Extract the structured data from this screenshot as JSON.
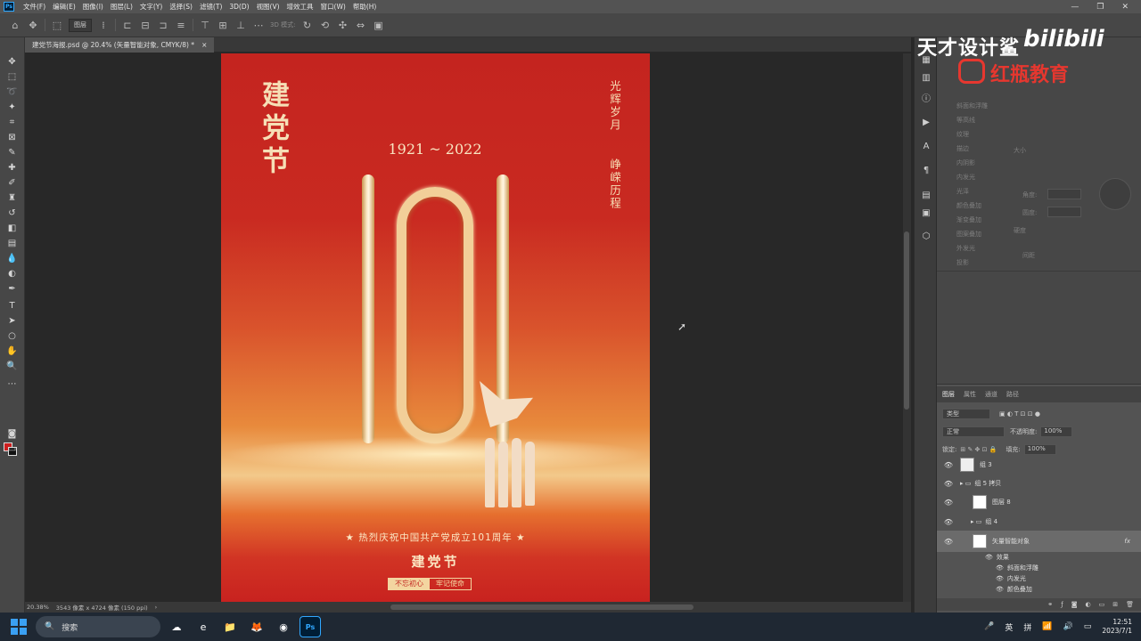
{
  "menu": {
    "app_icon": "Ps",
    "items": [
      "文件(F)",
      "编辑(E)",
      "图像(I)",
      "图层(L)",
      "文字(Y)",
      "选择(S)",
      "滤镜(T)",
      "3D(D)",
      "视图(V)",
      "增效工具",
      "窗口(W)",
      "帮助(H)"
    ],
    "window_controls": [
      "—",
      "❐",
      "✕"
    ]
  },
  "options": {
    "layer_select": "图层",
    "mode_3d": "3D 模式:"
  },
  "document": {
    "tab_title": "建党节海报.psd @ 20.4% (矢量智能对象, CMYK/8) *",
    "zoom": "20.38%",
    "dims": "3543 像素 x 4724 像素 (150 ppi)"
  },
  "poster": {
    "title": "建党节",
    "years": "1921 ~ 2022",
    "vertical_1": "光辉岁月",
    "vertical_2": "峥嵘历程",
    "big_number": "101",
    "banner": "★ 热烈庆祝中国共产党成立101周年 ★",
    "subtitle": "建党节",
    "tag_1": "不忘初心",
    "tag_2": "牢记使命"
  },
  "colors": {
    "poster_red": "#c8221f",
    "poster_gold": "#f3d5a0",
    "ui_dark": "#535353",
    "foreground": "#cc1f1f",
    "background": "#111111",
    "accent_watermark": "#e6372f"
  },
  "watermark": {
    "line1": "天才设计鲨",
    "line2": "bilibili",
    "line3": "红瓶教育"
  },
  "styles_panel": {
    "items": [
      "斜面和浮雕",
      "等高线",
      "纹理",
      "描边",
      "内阴影",
      "内发光",
      "光泽",
      "颜色叠加",
      "渐变叠加",
      "图案叠加",
      "外发光",
      "投影"
    ],
    "labels": [
      "大小",
      "角度:",
      "圆度:",
      "硬度",
      "间距"
    ]
  },
  "layers_panel": {
    "tabs": [
      "图层",
      "属性",
      "通道",
      "路径"
    ],
    "filter": "类型",
    "blend_mode": "正常",
    "opacity_label": "不透明度:",
    "opacity": "100%",
    "lock_label": "锁定:",
    "fill_label": "填充:",
    "fill": "100%",
    "layers": [
      {
        "name": "组 3"
      },
      {
        "name": "组 5 拷贝"
      },
      {
        "name": "图层 8"
      },
      {
        "name": "组 4"
      },
      {
        "name": "矢量智能对象"
      },
      {
        "name": "效果"
      },
      {
        "name": "斜面和浮雕"
      },
      {
        "name": "内发光"
      },
      {
        "name": "颜色叠加"
      }
    ],
    "fx": "fx"
  },
  "taskbar": {
    "search": "搜索",
    "ime_1": "英",
    "ime_2": "拼",
    "time": "12:51",
    "date": "2023/7/1"
  }
}
